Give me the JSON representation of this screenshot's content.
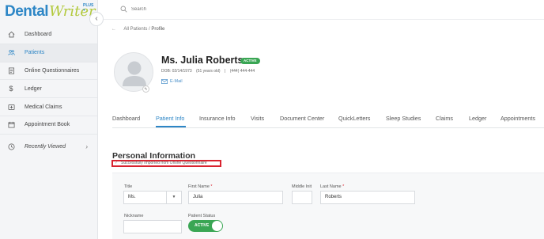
{
  "app": {
    "logo_main": "Dental",
    "logo_accent": "Writer",
    "logo_plus": "PLUS ▾"
  },
  "sidebar": {
    "items": [
      {
        "label": "Dashboard",
        "icon": "home-icon"
      },
      {
        "label": "Patients",
        "icon": "patients-icon",
        "active": true
      },
      {
        "label": "Online Questionnaires",
        "icon": "questionnaire-icon"
      },
      {
        "label": "Ledger",
        "icon": "dollar-icon"
      },
      {
        "label": "Medical Claims",
        "icon": "medical-claims-icon"
      },
      {
        "label": "Appointment Book",
        "icon": "calendar-icon"
      }
    ],
    "recent_label": "Recently Viewed"
  },
  "search": {
    "placeholder": "Search"
  },
  "breadcrumb": {
    "parent": "All Patients",
    "separator": "/",
    "current": "Profile"
  },
  "patient": {
    "name": "Ms. Julia Roberts",
    "status": "ACTIVE",
    "dob": "DOB: 02/14/1973",
    "age": "(51 years old)",
    "separator": "|",
    "phone": "(444) 444-444",
    "email_label": "E-Mail"
  },
  "tabs": [
    "Dashboard",
    "Patient Info",
    "Insurance Info",
    "Visits",
    "Document Center",
    "QuickLetters",
    "Sleep Studies",
    "Claims",
    "Ledger",
    "Appointments"
  ],
  "active_tab": "Patient Info",
  "personal_info": {
    "title": "Personal Information",
    "import_note": "Successfully Imported from Online Questionnaire",
    "fields": {
      "title_label": "Title",
      "title_value": "Ms.",
      "first_name_label": "First Name",
      "first_name_value": "Julia",
      "middle_label": "Middle Init",
      "middle_value": "",
      "last_name_label": "Last Name",
      "last_name_value": "Roberts",
      "nickname_label": "Nickname",
      "nickname_value": "",
      "status_label": "Patient Status",
      "status_value": "ACTIVE",
      "required_marker": "*"
    }
  },
  "colors": {
    "accent": "#2d86c6",
    "active_green": "#3aa654",
    "highlight_red": "#d9232f",
    "logo_green": "#b2c93c"
  }
}
